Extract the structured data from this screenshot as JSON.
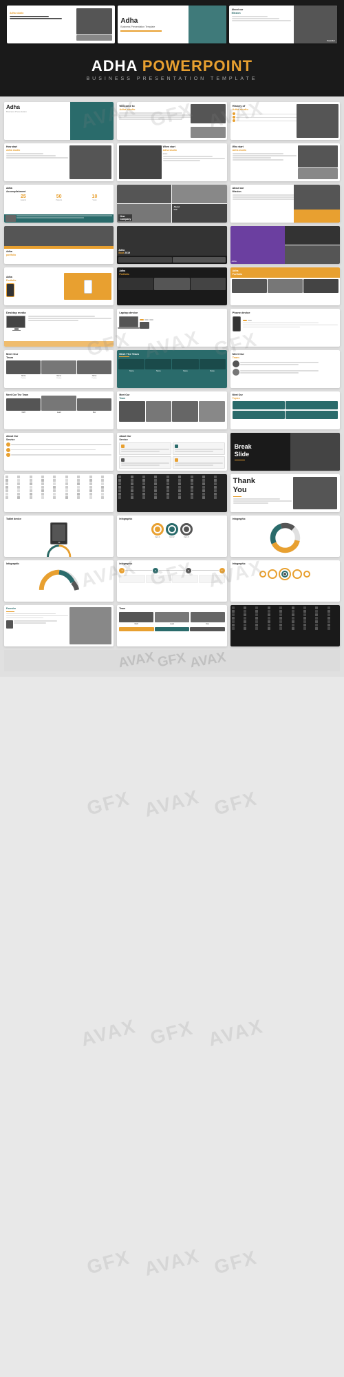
{
  "watermark": {
    "texts": [
      "AVAX",
      "GFX",
      "AVAX",
      "GFX"
    ]
  },
  "header": {
    "product_name": "ADHA POWERPOINT",
    "subtitle": "BUSINESS PRESENTATION TEMPLATE"
  },
  "slides": {
    "row1": [
      {
        "id": "s1",
        "label": "When start Adha studio",
        "type": "split-image"
      },
      {
        "id": "s2",
        "label": "Adha",
        "type": "title-center"
      },
      {
        "id": "s3",
        "label": "About our Mission",
        "type": "image-right"
      }
    ],
    "row2": [
      {
        "id": "s4",
        "label": "Adha",
        "type": "title-main"
      },
      {
        "id": "s5",
        "label": "Welcome to Adha studio",
        "type": "text-image"
      },
      {
        "id": "s6",
        "label": "History of Adha studio",
        "type": "text-image"
      }
    ],
    "row3": [
      {
        "id": "s7",
        "label": "How start Adha studio",
        "type": "image-text"
      },
      {
        "id": "s8",
        "label": "When start Adha studio 2019",
        "type": "image-text"
      },
      {
        "id": "s9",
        "label": "Who start Adha studio",
        "type": "image-text"
      }
    ],
    "row4": [
      {
        "id": "s10",
        "label": "Adha Accomplishment",
        "type": "stats"
      },
      {
        "id": "s11",
        "label": "About our",
        "type": "multi-image"
      },
      {
        "id": "s12",
        "label": "About our Mission",
        "type": "dark-image"
      }
    ],
    "row5": [
      {
        "id": "s13",
        "label": "Adha",
        "type": "portfolio-orange"
      },
      {
        "id": "s14",
        "label": "Adha Boot 2019",
        "type": "dark-split"
      },
      {
        "id": "s15",
        "label": "Adha",
        "type": "purple-split"
      }
    ],
    "row6": [
      {
        "id": "s16",
        "label": "Adha Portfolio",
        "type": "orange-phone"
      },
      {
        "id": "s17",
        "label": "Adha Portfolio",
        "type": "dark-multi"
      },
      {
        "id": "s18",
        "label": "Adha Portfolio",
        "type": "orange-multi"
      }
    ],
    "row7": [
      {
        "id": "s19",
        "label": "Desktop media",
        "type": "desktop"
      },
      {
        "id": "s20",
        "label": "Laptop device",
        "type": "laptop"
      },
      {
        "id": "s21",
        "label": "Phone device",
        "type": "phone"
      }
    ],
    "row8": [
      {
        "id": "s22",
        "label": "Meet Our Team",
        "type": "team-1"
      },
      {
        "id": "s23",
        "label": "Meet The Team",
        "type": "team-teal"
      },
      {
        "id": "s24",
        "label": "Meet Our Team",
        "type": "team-3"
      }
    ],
    "row9": [
      {
        "id": "s25",
        "label": "Meet Our The Team",
        "type": "team-4"
      },
      {
        "id": "s26",
        "label": "Meet Our Team",
        "type": "team-5"
      },
      {
        "id": "s27",
        "label": "Meet Our Topics",
        "type": "team-6"
      }
    ],
    "row10": [
      {
        "id": "s28",
        "label": "About Our Service",
        "type": "service-1"
      },
      {
        "id": "s29",
        "label": "About Our Service",
        "type": "service-2"
      },
      {
        "id": "s30",
        "label": "Break Slide",
        "type": "break"
      }
    ],
    "row11": [
      {
        "id": "s31",
        "label": "Icons",
        "type": "icon-grid-light"
      },
      {
        "id": "s32",
        "label": "Icons",
        "type": "icon-grid-dark"
      },
      {
        "id": "s33",
        "label": "Thank You",
        "type": "thankyou"
      }
    ],
    "row12": [
      {
        "id": "s34",
        "label": "Tablet device",
        "type": "tablet"
      },
      {
        "id": "s35",
        "label": "Infographic",
        "type": "infographic-circles"
      },
      {
        "id": "s36",
        "label": "Infographic",
        "type": "infographic-ring"
      }
    ],
    "row13": [
      {
        "id": "s37",
        "label": "Infographic",
        "type": "infographic-half"
      },
      {
        "id": "s38",
        "label": "Infographic",
        "type": "infographic-flow"
      },
      {
        "id": "s39",
        "label": "Infographic",
        "type": "infographic-dots"
      }
    ],
    "row14": [
      {
        "id": "s40",
        "label": "Founder",
        "type": "founder-1"
      },
      {
        "id": "s41",
        "label": "Team",
        "type": "team-table"
      },
      {
        "id": "s42",
        "label": "Icons dark",
        "type": "icon-grid-dark2"
      }
    ]
  }
}
